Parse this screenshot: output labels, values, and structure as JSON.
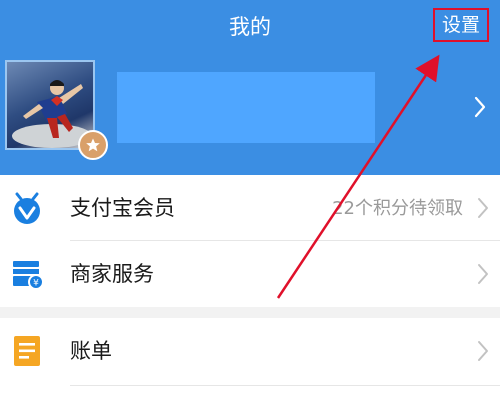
{
  "header": {
    "title": "我的",
    "settings_label": "设置",
    "accent_color": "#3b8ee3"
  },
  "profile": {
    "avatar_icon": "user-photo",
    "badge_icon": "star-badge-icon",
    "username_mask_color": "#4fa6ff"
  },
  "menu": {
    "group1": [
      {
        "label": "支付宝会员",
        "meta": "22个积分待领取",
        "icon": "member-icon"
      },
      {
        "label": "商家服务",
        "meta": "",
        "icon": "merchant-icon"
      }
    ],
    "group2": [
      {
        "label": "账单",
        "meta": "",
        "icon": "bill-icon"
      }
    ]
  },
  "annotation": {
    "highlight_color": "#e0102a",
    "arrow_color": "#e0102a"
  }
}
